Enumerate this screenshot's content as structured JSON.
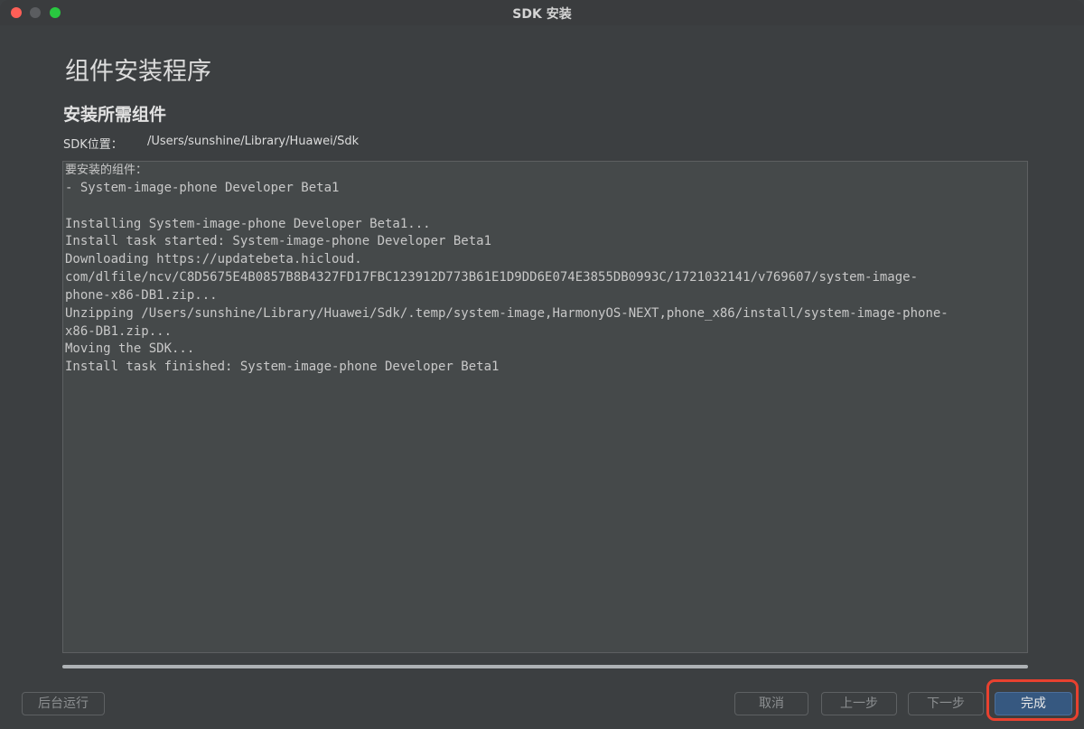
{
  "window": {
    "title": "SDK 安装"
  },
  "page": {
    "title": "组件安装程序",
    "section_title": "安装所需组件",
    "sdk_label": "SDK位置：",
    "sdk_path": "/Users/sunshine/Library/Huawei/Sdk"
  },
  "log": {
    "header": "要安装的组件：",
    "lines": [
      "- System-image-phone Developer Beta1",
      "",
      "Installing System-image-phone Developer Beta1...",
      "Install task started: System-image-phone Developer Beta1",
      "Downloading https://updatebeta.hicloud.",
      "com/dlfile/ncv/C8D5675E4B0857B8B4327FD17FBC123912D773B61E1D9DD6E074E3855DB0993C/1721032141/v769607/system-image-",
      "phone-x86-DB1.zip...",
      "Unzipping /Users/sunshine/Library/Huawei/Sdk/.temp/system-image,HarmonyOS-NEXT,phone_x86/install/system-image-phone-",
      "x86-DB1.zip...",
      "Moving the SDK...",
      "Install task finished: System-image-phone Developer Beta1"
    ]
  },
  "progress": {
    "value": 1.0
  },
  "buttons": {
    "background": "后台运行",
    "cancel": "取消",
    "previous": "上一步",
    "next": "下一步",
    "finish": "完成"
  },
  "colors": {
    "accent_button": "#365880",
    "highlight": "#e8412f"
  }
}
